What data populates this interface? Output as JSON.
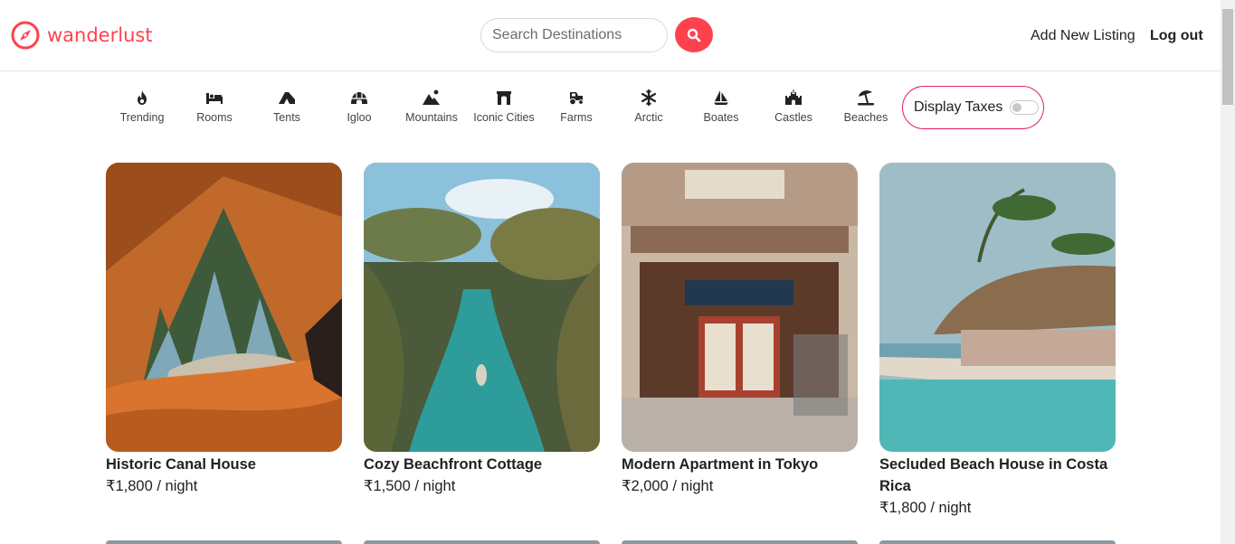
{
  "brand": {
    "name": "wanderlust",
    "icon": "compass-icon",
    "color": "#fe424d"
  },
  "search": {
    "placeholder": "Search Destinations",
    "value": "",
    "button_icon": "search-icon"
  },
  "nav": {
    "add_listing": "Add New Listing",
    "logout": "Log out"
  },
  "filters": [
    {
      "label": "Trending",
      "icon": "fire-icon"
    },
    {
      "label": "Rooms",
      "icon": "bed-icon"
    },
    {
      "label": "Tents",
      "icon": "tent-icon"
    },
    {
      "label": "Igloo",
      "icon": "igloo-icon"
    },
    {
      "label": "Mountains",
      "icon": "mountain-icon"
    },
    {
      "label": "Iconic Cities",
      "icon": "archway-icon"
    },
    {
      "label": "Farms",
      "icon": "tractor-icon"
    },
    {
      "label": "Arctic",
      "icon": "snowflake-icon"
    },
    {
      "label": "Boates",
      "icon": "sailboat-icon"
    },
    {
      "label": "Castles",
      "icon": "castle-icon"
    },
    {
      "label": "Beaches",
      "icon": "umbrella-beach-icon"
    }
  ],
  "tax_toggle": {
    "label": "Display Taxes",
    "on": false
  },
  "listings": [
    {
      "title": "Historic Canal House",
      "price": "₹1,800 / night"
    },
    {
      "title": "Cozy Beachfront Cottage",
      "price": "₹1,500 / night"
    },
    {
      "title": "Modern Apartment in Tokyo",
      "price": "₹2,000 / night"
    },
    {
      "title": "Secluded Beach House in Costa Rica",
      "price": "₹1,800 / night"
    }
  ],
  "colors": {
    "accent": "#fe424d",
    "toggle_border": "#e61e64"
  }
}
